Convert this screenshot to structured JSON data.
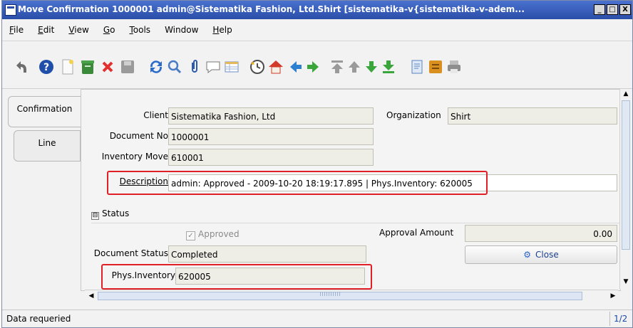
{
  "window": {
    "title": "Move Confirmation  1000001  admin@Sistematika Fashion, Ltd.Shirt [sistematika-v{sistematika-v-adem...",
    "minimize": "_",
    "maximize": "□",
    "close": "X"
  },
  "menu": {
    "items": [
      {
        "label": "File",
        "underline": "F",
        "rest": "ile"
      },
      {
        "label": "Edit",
        "underline": "E",
        "rest": "dit"
      },
      {
        "label": "View",
        "underline": "V",
        "rest": "iew"
      },
      {
        "label": "Go",
        "underline": "G",
        "rest": "o"
      },
      {
        "label": "Tools",
        "underline": "T",
        "rest": "ools"
      },
      {
        "label": "Window",
        "underline": "",
        "rest": "Window"
      },
      {
        "label": "Help",
        "underline": "H",
        "rest": "elp"
      }
    ]
  },
  "toolbar": {
    "icons": [
      "undo-icon",
      "help-icon",
      "new-record-icon",
      "save-icon",
      "delete-icon",
      "disk-icon",
      "refresh-icon",
      "find-icon",
      "attachment-icon",
      "chat-icon",
      "grid-toggle-icon",
      "history-icon",
      "home-icon",
      "previous-icon",
      "next-icon",
      "first-record-icon",
      "up-icon",
      "down-icon",
      "last-record-icon",
      "report-icon",
      "archive-icon",
      "print-icon"
    ]
  },
  "tabs": [
    {
      "label": "Confirmation",
      "active": true
    },
    {
      "label": "Line",
      "active": false
    }
  ],
  "form": {
    "client_label": "Client",
    "client_value": "Sistematika Fashion, Ltd",
    "organization_label": "Organization",
    "organization_value": "Shirt",
    "document_no_label": "Document No",
    "document_no_value": "1000001",
    "inventory_move_label": "Inventory Move",
    "inventory_move_value": "610001",
    "description_label": "Description",
    "description_value": "admin: Approved - 2009-10-20 18:19:17.895 | Phys.Inventory: 620005",
    "status_section": "Status",
    "status_collapse_symbol": "⊟",
    "approved_label": "Approved",
    "approved_checked": true,
    "approval_amount_label": "Approval Amount",
    "approval_amount_value": "0.00",
    "document_status_label": "Document Status",
    "document_status_value": "Completed",
    "close_button_label": "Close",
    "phys_inventory_label": "Phys.Inventory",
    "phys_inventory_value": "620005"
  },
  "highlight_color": "#e01f26",
  "statusbar": {
    "message": "Data requeried",
    "page": "1/2"
  }
}
